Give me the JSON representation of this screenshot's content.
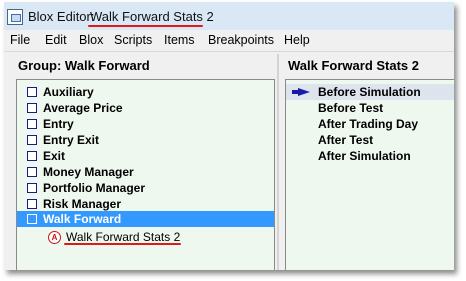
{
  "window": {
    "title_prefix": "Blox Editor:",
    "title_name": "Walk Forward Stats 2",
    "app_icon": "blox-editor-icon"
  },
  "menu": {
    "items": [
      "File",
      "Edit",
      "Blox",
      "Scripts",
      "Items",
      "Breakpoints",
      "Help"
    ]
  },
  "left_pane": {
    "header": "Group: Walk Forward",
    "groups": [
      {
        "label": "Auxiliary",
        "selected": false
      },
      {
        "label": "Average Price",
        "selected": false
      },
      {
        "label": "Entry",
        "selected": false
      },
      {
        "label": "Entry Exit",
        "selected": false
      },
      {
        "label": "Exit",
        "selected": false
      },
      {
        "label": "Money Manager",
        "selected": false
      },
      {
        "label": "Portfolio Manager",
        "selected": false
      },
      {
        "label": "Risk Manager",
        "selected": false
      },
      {
        "label": "Walk Forward",
        "selected": true
      }
    ],
    "child": {
      "badge": "A",
      "label": "Walk Forward Stats 2"
    }
  },
  "right_pane": {
    "header": "Walk Forward Stats 2",
    "scripts": [
      {
        "label": "Before Simulation",
        "active": true
      },
      {
        "label": "Before Test",
        "active": false
      },
      {
        "label": "After Trading Day",
        "active": false
      },
      {
        "label": "After Test",
        "active": false
      },
      {
        "label": "After Simulation",
        "active": false
      }
    ]
  },
  "colors": {
    "selection": "#3399ff",
    "list_background": "#eef8ee",
    "annotation_red": "#e01818",
    "arrow_blue": "#1a1aa8"
  }
}
